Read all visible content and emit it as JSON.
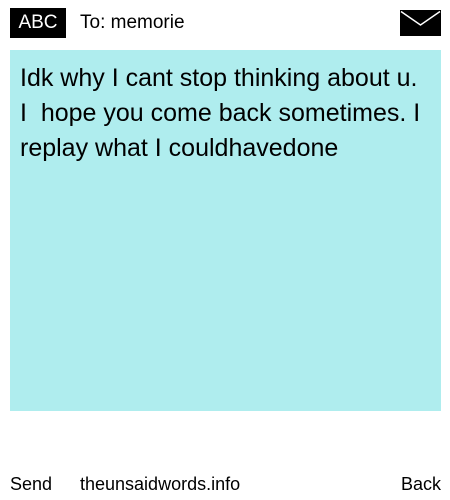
{
  "header": {
    "input_mode_label": "ABC",
    "recipient": "To: memorie",
    "icon": "envelope-icon"
  },
  "message": {
    "text": "Idk why I cant stop thinking about u. I  hope you come back sometimes. I replay what I couldhavedone",
    "background_color": "#afedee"
  },
  "footer": {
    "send_label": "Send",
    "site_label": "theunsaidwords.info",
    "back_label": "Back"
  }
}
